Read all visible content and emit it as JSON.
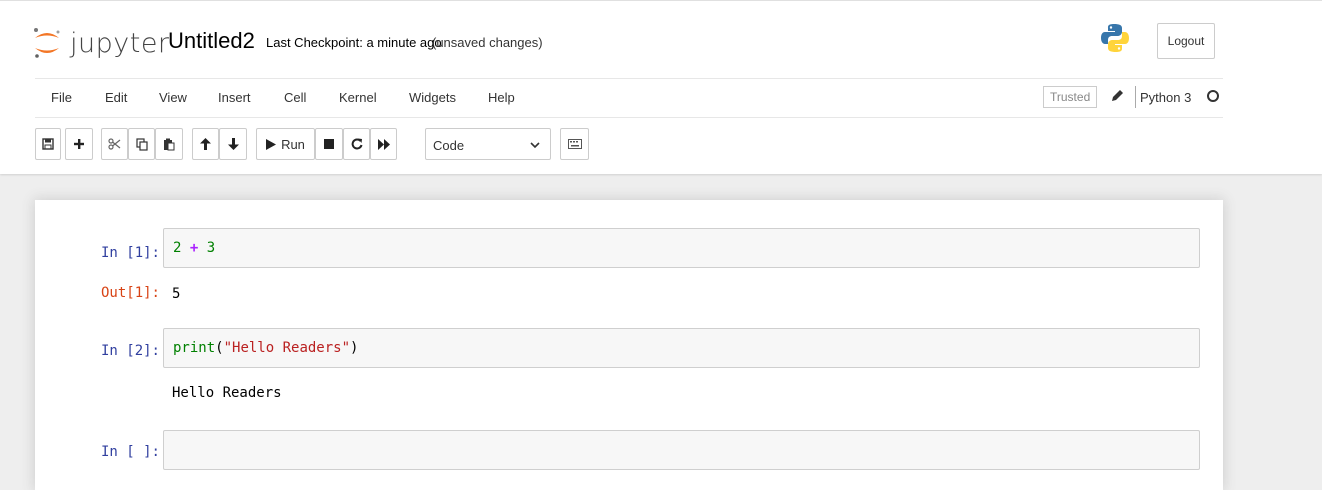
{
  "header": {
    "logo_text": "jupyter",
    "notebook_name": "Untitled2",
    "checkpoint": "Last Checkpoint: a minute ago",
    "unsaved": "(unsaved changes)",
    "logout_label": "Logout",
    "python_logo_icon": "python-logo-icon"
  },
  "menubar": {
    "items": [
      "File",
      "Edit",
      "View",
      "Insert",
      "Cell",
      "Kernel",
      "Widgets",
      "Help"
    ],
    "trusted_label": "Trusted",
    "kernel_name": "Python 3",
    "kernel_indicator_icon": "kernel-idle-circle-icon"
  },
  "toolbar": {
    "buttons": [
      "save-icon",
      "plus-icon",
      "cut-icon",
      "copy-icon",
      "paste-icon",
      "arrow-up-icon",
      "arrow-down-icon",
      "run-button",
      "stop-icon",
      "restart-icon",
      "fast-forward-icon"
    ],
    "run_label": "Run",
    "cell_type": "Code",
    "keyboard_icon": "keyboard-icon"
  },
  "cells": [
    {
      "in_prompt": "In [1]:",
      "code_tokens": [
        {
          "text": "2",
          "kind": "num"
        },
        {
          "text": " ",
          "kind": "p"
        },
        {
          "text": "+",
          "kind": "op"
        },
        {
          "text": " ",
          "kind": "p"
        },
        {
          "text": "3",
          "kind": "num"
        }
      ],
      "out_prompt": "Out[1]:",
      "output": "5"
    },
    {
      "in_prompt": "In [2]:",
      "code_tokens": [
        {
          "text": "print",
          "kind": "builtin"
        },
        {
          "text": "(",
          "kind": "p"
        },
        {
          "text": "\"Hello Readers\"",
          "kind": "str"
        },
        {
          "text": ")",
          "kind": "p"
        }
      ],
      "output": "Hello Readers"
    },
    {
      "in_prompt": "In [ ]:"
    }
  ],
  "colors": {
    "in_prompt": "#303f9f",
    "out_prompt": "#d84315",
    "jupyter_orange": "#f37626"
  }
}
